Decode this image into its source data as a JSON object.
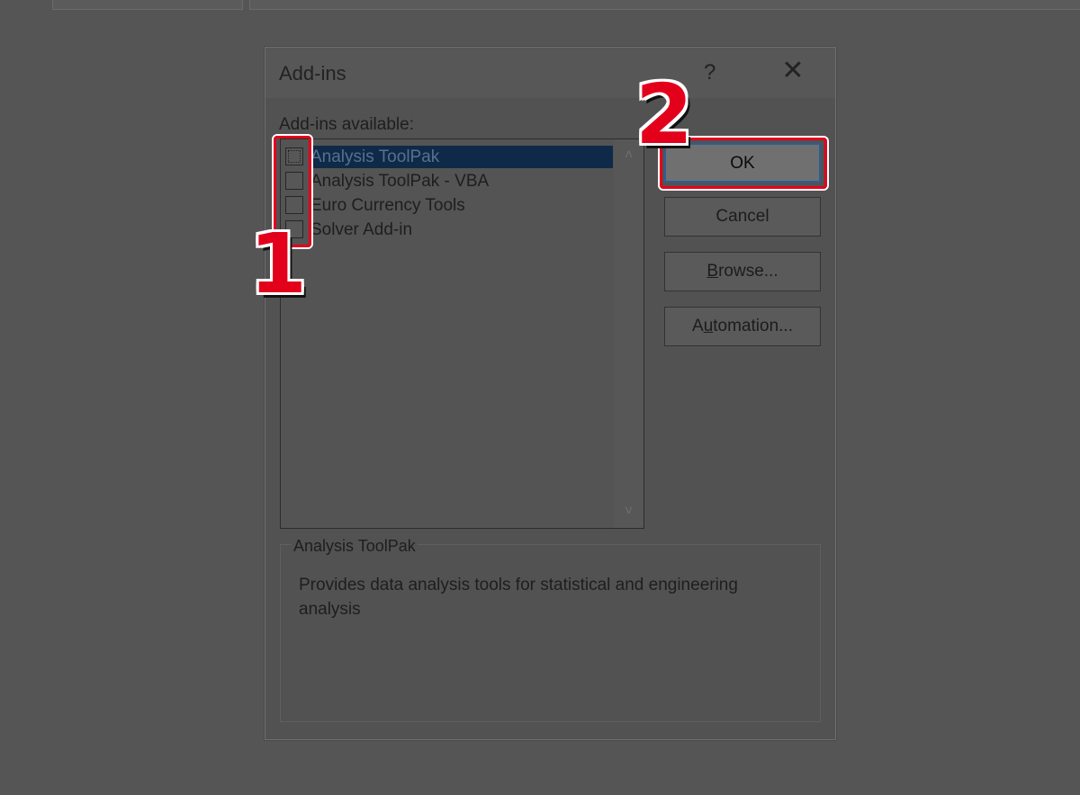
{
  "dialog": {
    "title": "Add-ins",
    "help_label": "?",
    "close_label": "✕",
    "available_label": "Add-ins available:",
    "addins": [
      {
        "label": "Analysis ToolPak",
        "checked": false,
        "selected": true
      },
      {
        "label": "Analysis ToolPak - VBA",
        "checked": false,
        "selected": false
      },
      {
        "label": "Euro Currency Tools",
        "checked": false,
        "selected": false
      },
      {
        "label": "Solver Add-in",
        "checked": false,
        "selected": false
      }
    ],
    "buttons": {
      "ok": "OK",
      "cancel": "Cancel",
      "browse_prefix": "",
      "browse_mnemonic": "B",
      "browse_rest": "rowse...",
      "automation_prefix": "A",
      "automation_mnemonic": "u",
      "automation_rest": "tomation..."
    },
    "description": {
      "title": "Analysis ToolPak",
      "text": "Provides data analysis tools for statistical and engineering analysis"
    }
  },
  "annotations": {
    "step1": "1",
    "step2": "2",
    "color": "#e3001b"
  },
  "icons": {
    "scroll_up": "˄",
    "scroll_down": "˅"
  }
}
